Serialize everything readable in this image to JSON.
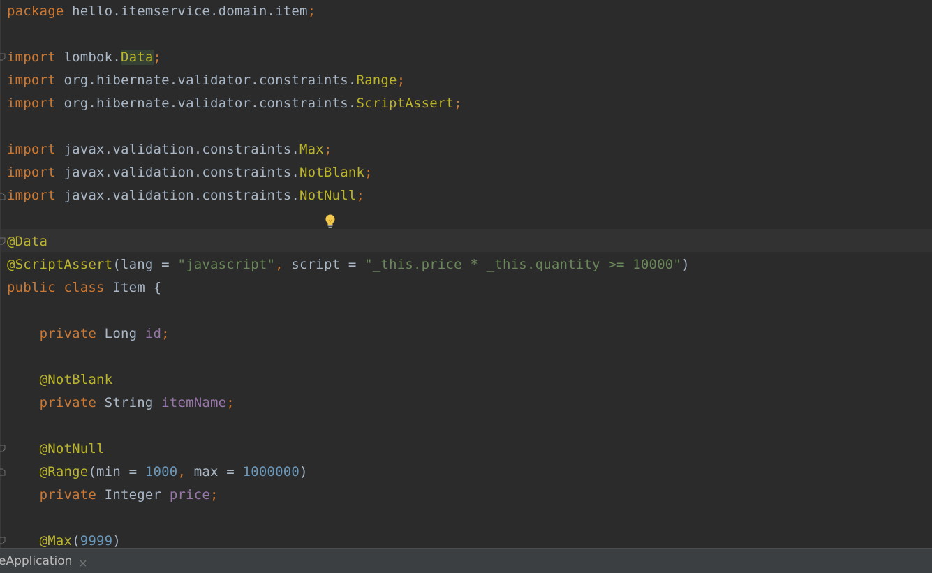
{
  "editor": {
    "lines": {
      "l1_kw": "package",
      "l1_rest": " hello.itemservice.domain.item",
      "l1_semi": ";",
      "import_kw": "import",
      "l3_rest": " lombok.",
      "l3_cls": "Data",
      "l3_semi": ";",
      "l4_rest": " org.hibernate.validator.constraints.",
      "l4_cls": "Range",
      "l4_semi": ";",
      "l5_rest": " org.hibernate.validator.constraints.",
      "l5_cls": "ScriptAssert",
      "l5_semi": ";",
      "l7_rest": " javax.validation.constraints.",
      "l7_cls": "Max",
      "l7_semi": ";",
      "l8_rest": " javax.validation.constraints.",
      "l8_cls": "NotBlank",
      "l8_semi": ";",
      "l9_rest": " javax.validation.constraints.",
      "l9_cls": "NotNull",
      "l9_semi": ";",
      "l11_ann": "@Data",
      "l12_ann": "@ScriptAssert",
      "l12_p1": "(lang = ",
      "l12_s1": "\"javascript\"",
      "l12_comma": ", ",
      "l12_p2": "script = ",
      "l12_s2": "\"_this.price * _this.quantity >= 10000\"",
      "l12_p3": ")",
      "l13_kw1": "public",
      "l13_kw2": "class",
      "l13_rest": " Item {",
      "private_kw": "private",
      "l15_type": " Long ",
      "l15_field": "id",
      "l15_semi": ";",
      "l17_ann": "@NotBlank",
      "l18_type": " String ",
      "l18_field": "itemName",
      "l18_semi": ";",
      "l20_ann": "@NotNull",
      "l21_ann": "@Range",
      "l21_p1": "(min = ",
      "l21_n1": "1000",
      "l21_comma": ", ",
      "l21_p2": "max = ",
      "l21_n2": "1000000",
      "l21_p3": ")",
      "l22_type": " Integer ",
      "l22_field": "price",
      "l22_semi": ";",
      "l24_ann": "@Max",
      "l24_p1": "(",
      "l24_n1": "9999",
      "l24_p2": ")"
    },
    "intention_icon": "lightbulb-icon"
  },
  "statusbar": {
    "run_tab_label": "eApplication",
    "close_icon": "close-icon"
  },
  "colors": {
    "background": "#2b2b2b",
    "keyword": "#cc7832",
    "annotation": "#bbb529",
    "string": "#6a8759",
    "number": "#6897bb",
    "field": "#9876aa",
    "text": "#a9b7c6",
    "statusbar": "#3c3f41"
  }
}
